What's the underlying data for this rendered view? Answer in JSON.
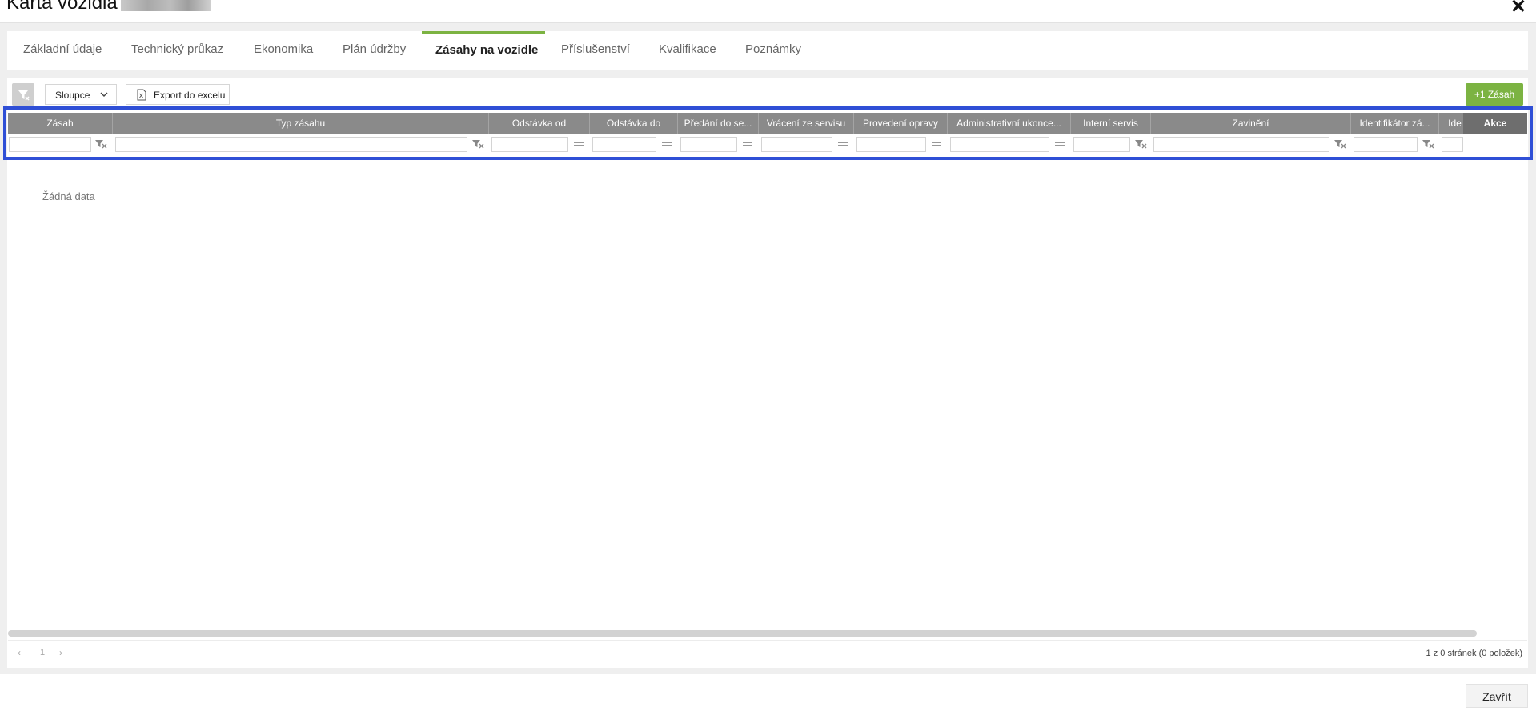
{
  "window": {
    "title": "Karta vozidla"
  },
  "tabs": [
    {
      "label": "Základní údaje"
    },
    {
      "label": "Technický průkaz"
    },
    {
      "label": "Ekonomika"
    },
    {
      "label": "Plán údržby"
    },
    {
      "label": "Zásahy na vozidle"
    },
    {
      "label": "Příslušenství"
    },
    {
      "label": "Kvalifikace"
    },
    {
      "label": "Poznámky"
    }
  ],
  "active_tab": "Zásahy na vozidle",
  "toolbar": {
    "columns_label": "Sloupce",
    "export_label": "Export do excelu",
    "add_label": "+1 Zásah"
  },
  "grid": {
    "columns": [
      {
        "label": "Zásah"
      },
      {
        "label": "Typ zásahu"
      },
      {
        "label": "Odstávka od"
      },
      {
        "label": "Odstávka do"
      },
      {
        "label": "Předání do se..."
      },
      {
        "label": "Vrácení ze servisu"
      },
      {
        "label": "Provedení opravy"
      },
      {
        "label": "Administrativní ukonce..."
      },
      {
        "label": "Interní servis"
      },
      {
        "label": "Zavinění"
      },
      {
        "label": "Identifikátor zá..."
      },
      {
        "label": "Ide"
      }
    ],
    "actions_label": "Akce",
    "no_data": "Žádná data"
  },
  "pager": {
    "current_page": "1",
    "info": "1 z 0 stránek (0 položek)"
  },
  "footer": {
    "close_label": "Zavřít"
  },
  "colors": {
    "accent_green": "#7cb342",
    "highlight_blue": "#2f4fd6",
    "top_accent": "#1fc0b9"
  }
}
